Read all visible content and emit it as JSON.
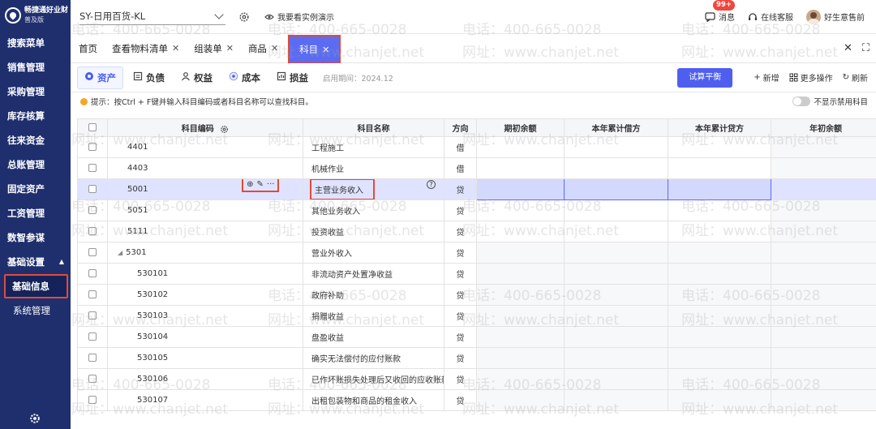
{
  "app": {
    "brand": "畅捷通好业财",
    "edition": "普及版"
  },
  "sidebar": {
    "items": [
      {
        "label": "搜索菜单"
      },
      {
        "label": "销售管理"
      },
      {
        "label": "采购管理"
      },
      {
        "label": "库存核算"
      },
      {
        "label": "往来资金"
      },
      {
        "label": "总账管理"
      },
      {
        "label": "固定资产"
      },
      {
        "label": "工资管理"
      },
      {
        "label": "数智参谋"
      },
      {
        "label": "基础设置"
      }
    ],
    "subitems": [
      {
        "label": "基础信息",
        "active": true
      },
      {
        "label": "系统管理",
        "active": false
      }
    ]
  },
  "topbar": {
    "company": "SY-日用百货-KL",
    "demo": "我要看实例演示",
    "messages": "消息",
    "badge": "99+",
    "service": "在线客服",
    "user": "好生意售前"
  },
  "tabs": [
    {
      "label": "首页",
      "closable": false
    },
    {
      "label": "查看物料清单",
      "closable": true
    },
    {
      "label": "组装单",
      "closable": true
    },
    {
      "label": "商品",
      "closable": true
    },
    {
      "label": "科目",
      "closable": true,
      "active": true
    }
  ],
  "toolbar": {
    "categories": [
      {
        "label": "资产",
        "active": true
      },
      {
        "label": "负债"
      },
      {
        "label": "权益"
      },
      {
        "label": "成本"
      },
      {
        "label": "损益"
      }
    ],
    "period": "启用期间：2024.12",
    "trial_balance": "试算平衡",
    "add": "新增",
    "more": "更多操作",
    "refresh": "刷新"
  },
  "hint": {
    "text": "提示：按Ctrl + F键并输入科目编码或者科目名称可以查找科目。",
    "toggle_label": "不显示禁用科目"
  },
  "table": {
    "columns": [
      "科目编码",
      "科目名称",
      "方向",
      "期初余额",
      "本年累计借方",
      "本年累计贷方",
      "年初余额"
    ],
    "rows": [
      {
        "code": "4401",
        "name": "工程施工",
        "dir": "借",
        "level": 1
      },
      {
        "code": "4403",
        "name": "机械作业",
        "dir": "借",
        "level": 1
      },
      {
        "code": "5001",
        "name": "主营业务收入",
        "dir": "贷",
        "level": 1,
        "selected": true
      },
      {
        "code": "5051",
        "name": "其他业务收入",
        "dir": "贷",
        "level": 1
      },
      {
        "code": "5111",
        "name": "投资收益",
        "dir": "贷",
        "level": 1
      },
      {
        "code": "5301",
        "name": "营业外收入",
        "dir": "贷",
        "level": 1,
        "expanded": true
      },
      {
        "code": "530101",
        "name": "非流动资产处置净收益",
        "dir": "贷",
        "level": 2
      },
      {
        "code": "530102",
        "name": "政府补助",
        "dir": "贷",
        "level": 2
      },
      {
        "code": "530103",
        "name": "捐赠收益",
        "dir": "贷",
        "level": 2
      },
      {
        "code": "530104",
        "name": "盘盈收益",
        "dir": "贷",
        "level": 2
      },
      {
        "code": "530105",
        "name": "确实无法偿付的应付账款",
        "dir": "贷",
        "level": 2
      },
      {
        "code": "530106",
        "name": "已作坏账损失处理后又收回的应收账款",
        "dir": "贷",
        "level": 2
      },
      {
        "code": "530107",
        "name": "出租包装物和商品的租金收入",
        "dir": "贷",
        "level": 2
      }
    ]
  },
  "watermark": {
    "phone": "电话：400-665-0028",
    "site": "网址：www.chanjet.net"
  },
  "colors": {
    "sidebar": "#1f2f6e",
    "primary": "#4e5ff0",
    "highlight": "#e24a3b",
    "selected_row": "#dfe3ff"
  }
}
